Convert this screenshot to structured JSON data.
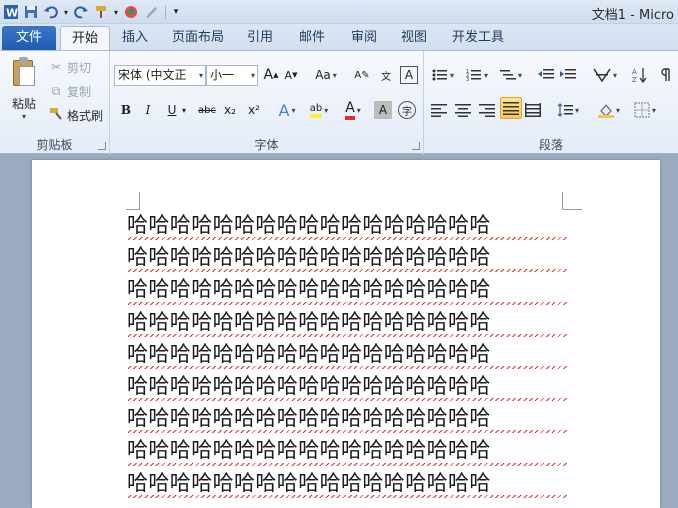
{
  "app": {
    "title": "文档1 - Micro"
  },
  "tabs": {
    "file": "文件",
    "items": [
      "开始",
      "插入",
      "页面布局",
      "引用",
      "邮件",
      "审阅",
      "视图",
      "开发工具"
    ],
    "active": "开始"
  },
  "clipboard": {
    "paste": "粘贴",
    "cut": "剪切",
    "copy": "复制",
    "format_painter": "格式刷",
    "group_label": "剪贴板"
  },
  "font": {
    "font_name": "宋体 (中文正",
    "font_size": "小一",
    "group_label": "字体",
    "buttons": [
      "B",
      "I",
      "U",
      "abc",
      "x₂",
      "x²",
      "A",
      "ab",
      "A",
      "A",
      "字"
    ]
  },
  "paragraph": {
    "group_label": "段落"
  },
  "document": {
    "lines": [
      "哈哈哈哈哈哈哈哈哈哈哈哈哈哈哈哈哈",
      "哈哈哈哈哈哈哈哈哈哈哈哈哈哈哈哈哈",
      "哈哈哈哈哈哈哈哈哈哈哈哈哈哈哈哈哈",
      "哈哈哈哈哈哈哈哈哈哈哈哈哈哈哈哈哈",
      "哈哈哈哈哈哈哈哈哈哈哈哈哈哈哈哈哈",
      "哈哈哈哈哈哈哈哈哈哈哈哈哈哈哈哈哈",
      "哈哈哈哈哈哈哈哈哈哈哈哈哈哈哈哈哈",
      "哈哈哈哈哈哈哈哈哈哈哈哈哈哈哈哈哈",
      "哈哈哈哈哈哈哈哈哈哈哈哈哈哈哈哈哈"
    ]
  },
  "colors": {
    "file_tab": "#2a67c0",
    "spell_error": "#e12d2d",
    "highlight_button": "#f9c94b"
  }
}
